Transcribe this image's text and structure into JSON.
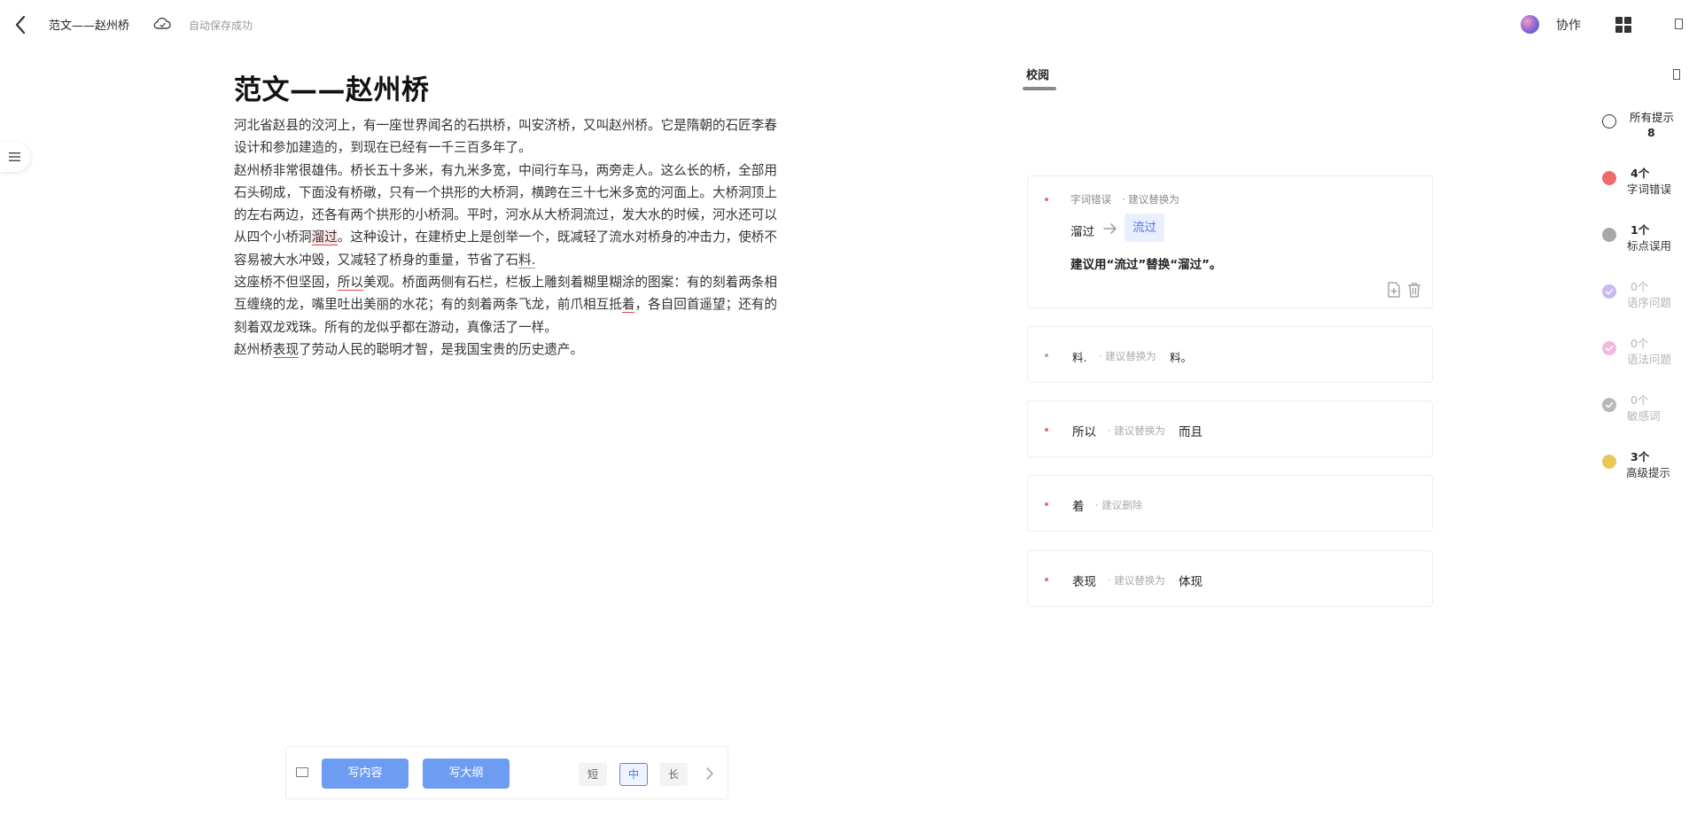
{
  "topbar": {
    "doc_name": "范文——赵州桥",
    "save_status": "自动保存成功",
    "collab_label": "协作"
  },
  "document": {
    "title": "范文——赵州桥",
    "p1": "河北省赵县的洨河上，有一座世界闻名的石拱桥，叫安济桥，又叫赵州桥。它是隋朝的石匠李春设计和参加建造的，到现在已经有一千三百多年了。",
    "p2": {
      "a": "赵州桥非常很雄伟。桥长五十多米，有九米多宽，中间行车马，两旁走人。这么长的桥，全部用石头砌成，下面没有桥礅，只有一个拱形的大桥洞，横跨在三十七米多宽的河面上。大桥洞顶上的左右两边，还各有两个拱形的小桥洞。平时，河水从大桥洞流过，发大水的时候，河水还可以从四个小桥洞",
      "err": "溜过",
      "b": "。这种设计，在建桥史上是创举一个，既减轻了流水对桥身的冲击力，使桥不容易被大水冲毁，又减轻了桥身的重量，节省了石",
      "err2": "料.",
      "c": ""
    },
    "p3": {
      "a": "这座桥不但坚固，",
      "err": "所以",
      "b": "美观。桥面两侧有石栏，栏板上雕刻着糊里糊涂的图案：有的刻着两条相互缠绕的龙，嘴里吐出美丽的水花；有的刻着两条飞龙，前爪相互抵",
      "err2": "着",
      "c": "，各自回首遥望；还有的刻着双龙戏珠。所有的龙似乎都在游动，真像活了一样。"
    },
    "p4": {
      "a": "赵州桥",
      "err": "表现",
      "b": "了劳动人民的聪明才智，是我国宝贵的历史遗产。"
    }
  },
  "write_bar": {
    "write_content": "写内容",
    "write_outline": "写大纲",
    "len_short": "短",
    "len_mid": "中",
    "len_long": "长"
  },
  "review": {
    "tab_label": "校阅",
    "cards": [
      {
        "category": "字词错误",
        "suggest_label": "· 建议替换为",
        "original": "溜过",
        "replacement": "流过",
        "tip": "建议用“流过”替换“溜过”。"
      },
      {
        "original": "料.",
        "suggest_label": "· 建议替换为",
        "replacement": "料。"
      },
      {
        "original": "所以",
        "suggest_label": "· 建议替换为",
        "replacement": "而且"
      },
      {
        "original": "着",
        "suggest_label": "· 建议删除",
        "replacement": ""
      },
      {
        "original": "表现",
        "suggest_label": "· 建议替换为",
        "replacement": "体现"
      }
    ]
  },
  "filters": [
    {
      "count": "所有提示",
      "label": "8",
      "color": "#ffffff",
      "dim": false
    },
    {
      "count": "4个",
      "label": "字词错误",
      "color": "#ef6b6b",
      "dim": false
    },
    {
      "count": "1个",
      "label": "标点误用",
      "color": "#a8a8a8",
      "dim": false
    },
    {
      "count": "0个",
      "label": "语序问题",
      "color": "#c9b8f2",
      "dim": true
    },
    {
      "count": "0个",
      "label": "语法问题",
      "color": "#f2b8e0",
      "dim": true
    },
    {
      "count": "0个",
      "label": "敏感词",
      "color": "#b8b8b8",
      "dim": true
    },
    {
      "count": "3个",
      "label": "高级提示",
      "color": "#e9c75a",
      "dim": false
    }
  ],
  "colors": {
    "accent": "#6e9cf2",
    "error_red": "#e04848"
  },
  "icons": [
    "back-arrow-icon",
    "cloud-icon",
    "grid-icon",
    "menu-icon",
    "arrow-right-icon",
    "add-note-icon",
    "trash-icon",
    "chevron-right-icon"
  ]
}
